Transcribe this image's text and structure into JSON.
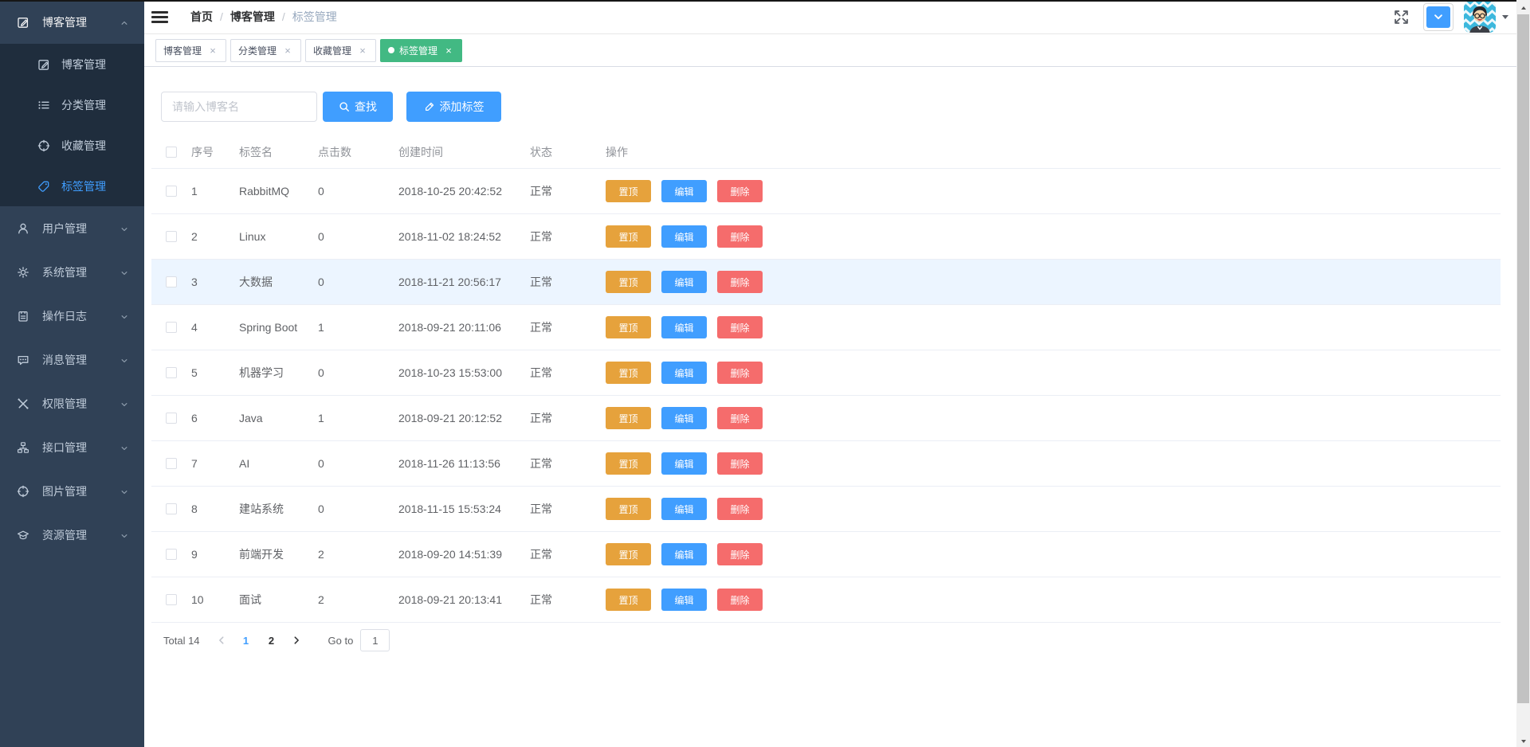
{
  "colors": {
    "primary": "#409eff",
    "tab_active_green": "#42b983",
    "warning_orange": "#e6a23c",
    "danger_red": "#f56c6c",
    "sidebar_bg": "#304156",
    "submenu_bg": "#1f2d3d",
    "row_highlight": "#ecf5ff"
  },
  "sidebar": {
    "menu": [
      {
        "key": "blog-group",
        "label": "博客管理",
        "icon": "edit-icon",
        "expanded": true,
        "children": [
          {
            "key": "blog",
            "label": "博客管理",
            "icon": "edit-icon"
          },
          {
            "key": "category",
            "label": "分类管理",
            "icon": "list-icon"
          },
          {
            "key": "favorite",
            "label": "收藏管理",
            "icon": "aim-icon"
          },
          {
            "key": "tag",
            "label": "标签管理",
            "icon": "tag-icon",
            "active": true
          }
        ]
      },
      {
        "key": "user",
        "label": "用户管理",
        "icon": "user-icon"
      },
      {
        "key": "system",
        "label": "系统管理",
        "icon": "gear-icon"
      },
      {
        "key": "log",
        "label": "操作日志",
        "icon": "log-icon"
      },
      {
        "key": "message",
        "label": "消息管理",
        "icon": "message-icon"
      },
      {
        "key": "permission",
        "label": "权限管理",
        "icon": "tools-icon"
      },
      {
        "key": "api",
        "label": "接口管理",
        "icon": "tree-icon"
      },
      {
        "key": "image",
        "label": "图片管理",
        "icon": "aim-icon"
      },
      {
        "key": "resource",
        "label": "资源管理",
        "icon": "education-icon"
      }
    ]
  },
  "header": {
    "breadcrumb": [
      "首页",
      "博客管理",
      "标签管理"
    ],
    "right_icons": [
      "fullscreen-icon",
      "chevron-down-icon",
      "avatar",
      "caret-down-icon"
    ]
  },
  "tabs": [
    {
      "key": "blog",
      "label": "博客管理"
    },
    {
      "key": "category",
      "label": "分类管理"
    },
    {
      "key": "favorite",
      "label": "收藏管理"
    },
    {
      "key": "tag",
      "label": "标签管理",
      "active": true
    }
  ],
  "tab_close_glyph": "×",
  "toolbar": {
    "search_placeholder": "请输入博客名",
    "search_label": "查找",
    "search_icon": "search-icon",
    "add_label": "添加标签",
    "add_icon": "pen-icon"
  },
  "table": {
    "columns": [
      "序号",
      "标签名",
      "点击数",
      "创建时间",
      "状态",
      "操作"
    ],
    "action_labels": {
      "top": "置顶",
      "edit": "编辑",
      "delete": "删除"
    },
    "rows": [
      {
        "id": "1",
        "name": "RabbitMQ",
        "clicks": "0",
        "created": "2018-10-25 20:42:52",
        "status": "正常"
      },
      {
        "id": "2",
        "name": "Linux",
        "clicks": "0",
        "created": "2018-11-02 18:24:52",
        "status": "正常"
      },
      {
        "id": "3",
        "name": "大数据",
        "clicks": "0",
        "created": "2018-11-21 20:56:17",
        "status": "正常",
        "highlighted": true
      },
      {
        "id": "4",
        "name": "Spring Boot",
        "clicks": "1",
        "created": "2018-09-21 20:11:06",
        "status": "正常"
      },
      {
        "id": "5",
        "name": "机器学习",
        "clicks": "0",
        "created": "2018-10-23 15:53:00",
        "status": "正常"
      },
      {
        "id": "6",
        "name": "Java",
        "clicks": "1",
        "created": "2018-09-21 20:12:52",
        "status": "正常"
      },
      {
        "id": "7",
        "name": "AI",
        "clicks": "0",
        "created": "2018-11-26 11:13:56",
        "status": "正常"
      },
      {
        "id": "8",
        "name": "建站系统",
        "clicks": "0",
        "created": "2018-11-15 15:53:24",
        "status": "正常"
      },
      {
        "id": "9",
        "name": "前端开发",
        "clicks": "2",
        "created": "2018-09-20 14:51:39",
        "status": "正常"
      },
      {
        "id": "10",
        "name": "面试",
        "clicks": "2",
        "created": "2018-09-21 20:13:41",
        "status": "正常"
      }
    ]
  },
  "pagination": {
    "total_label": "Total 14",
    "pages": [
      {
        "label": "1",
        "active": true
      },
      {
        "label": "2"
      }
    ],
    "goto_label": "Go to",
    "goto_value": "1"
  }
}
